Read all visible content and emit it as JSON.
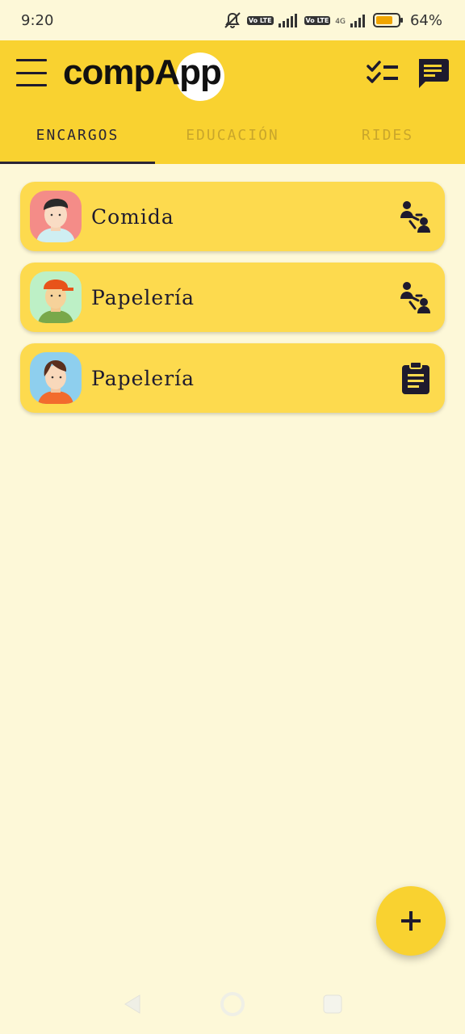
{
  "status_bar": {
    "time": "9:20",
    "lte_label_1": "Vo LTE",
    "lte_label_2": "Vo LTE",
    "network_type": "4G",
    "battery_percent": "64%",
    "icons": [
      "mute-icon",
      "signal-icon",
      "battery-icon"
    ]
  },
  "app_bar": {
    "logo_part1": "comp",
    "logo_part2": "App",
    "actions": [
      "tasks-icon",
      "chat-icon"
    ],
    "menu_icon": "menu-icon"
  },
  "tabs": [
    {
      "label": "ENCARGOS",
      "active": true
    },
    {
      "label": "EDUCACIÓN",
      "active": false
    },
    {
      "label": "RIDES",
      "active": false
    }
  ],
  "items": [
    {
      "label": "Comida",
      "status_icon": "delivery-icon",
      "avatar": "avatar-man"
    },
    {
      "label": "Papelería",
      "status_icon": "delivery-icon",
      "avatar": "avatar-cap"
    },
    {
      "label": "Papelería",
      "status_icon": "clipboard-icon",
      "avatar": "avatar-woman"
    }
  ],
  "fab": {
    "label": "+",
    "icon": "plus-icon"
  },
  "colors": {
    "primary": "#f9d230",
    "card": "#fdda4e",
    "background": "#fdf8d8",
    "text_dark": "#1e1a2e",
    "tab_inactive": "#c9a62b"
  }
}
